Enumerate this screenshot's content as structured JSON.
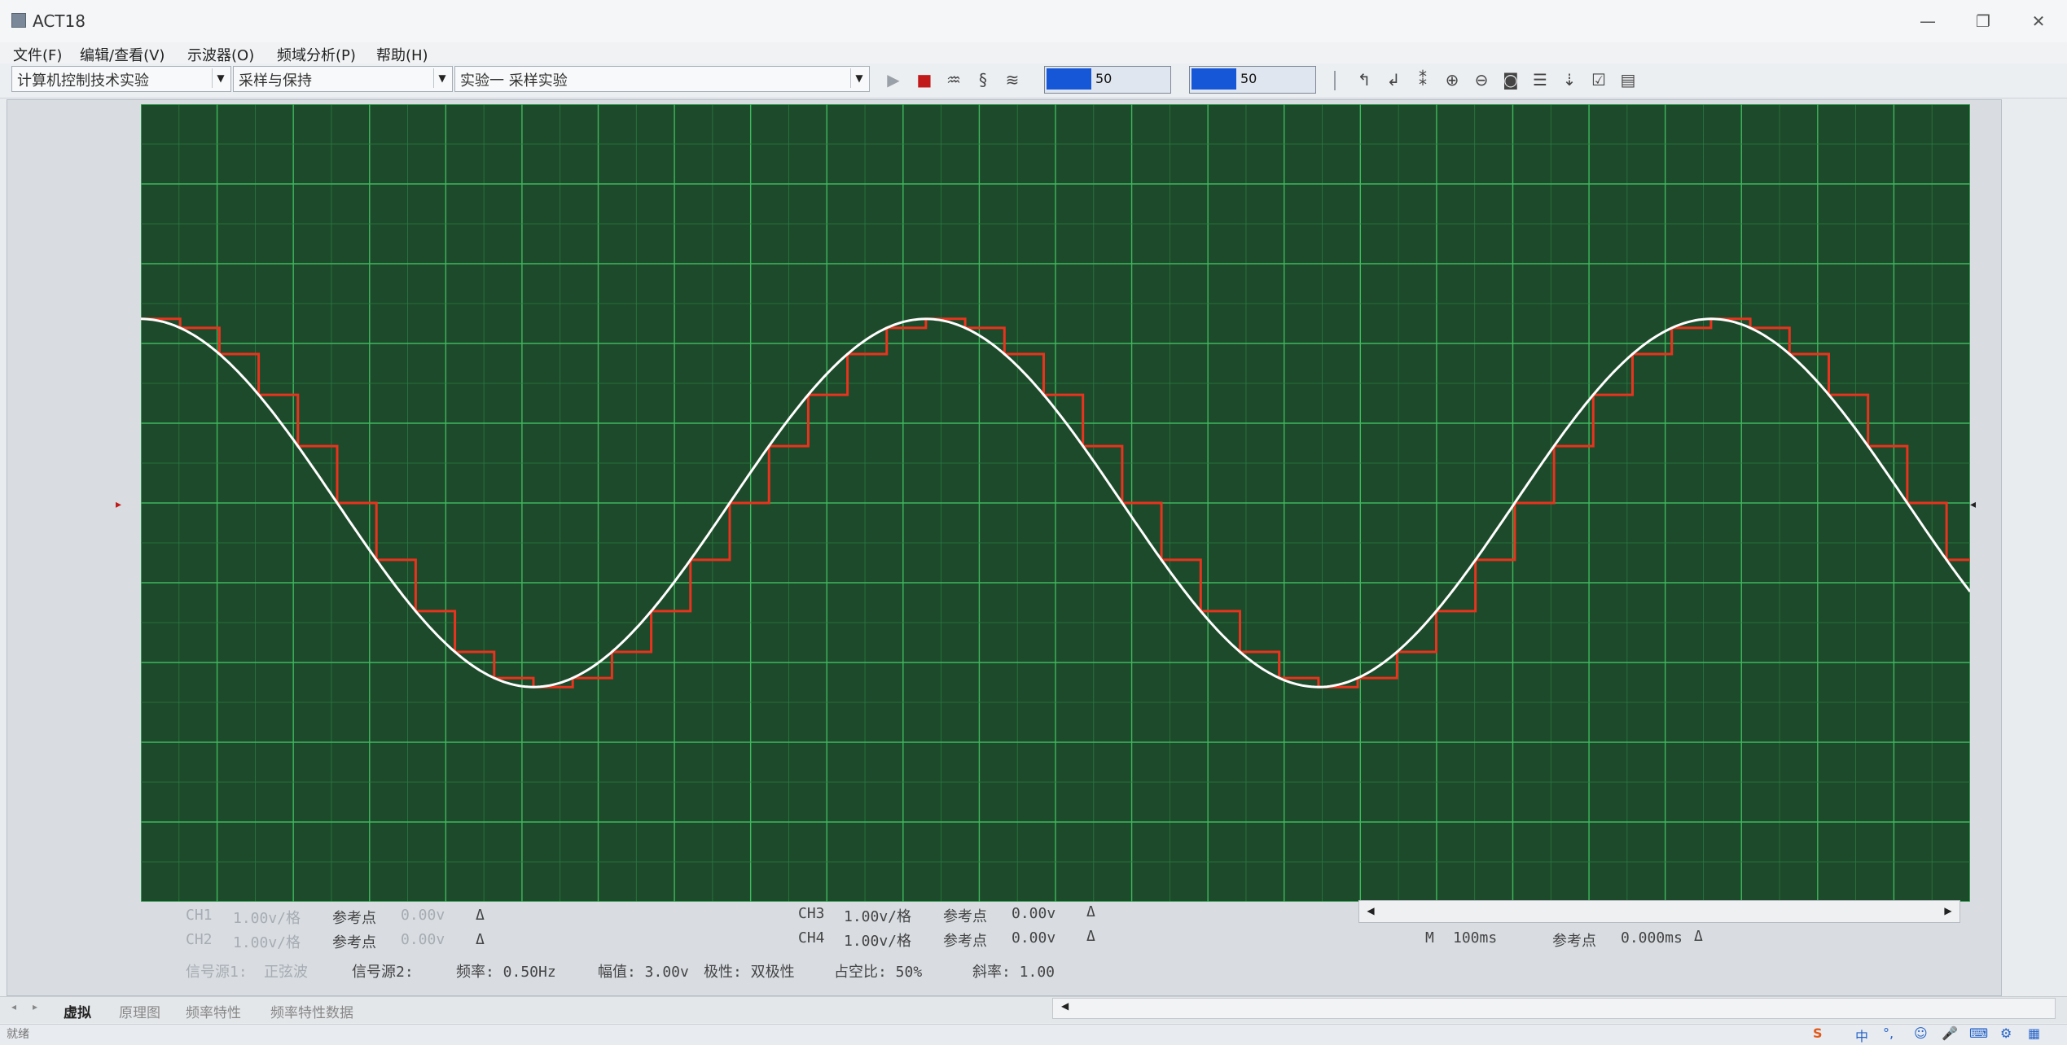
{
  "window": {
    "title": "ACT18"
  },
  "window_buttons": {
    "minimize": "—",
    "maximize": "❐",
    "close": "✕"
  },
  "menu": [
    "文件(F)",
    "编辑/查看(V)",
    "示波器(O)",
    "频域分析(P)",
    "帮助(H)"
  ],
  "toolbar": {
    "combo1": "计算机控制技术实验",
    "combo2": "采样与保持",
    "combo3": "实验一  采样实验",
    "play": "▶",
    "stop": "■",
    "slider1_value": "50",
    "slider2_value": "50"
  },
  "scope": {
    "background": "#1d4a2a",
    "grid_major": "#3fb85e",
    "grid_minor": "#2c7a43",
    "input_color": "#ffffff",
    "output_color": "#e8331e",
    "signal_freq_hz": 0.5,
    "amplitude_v": 3.0,
    "volts_per_div": 1.0,
    "time_per_div_ms": 100,
    "sample_period_ms": 100
  },
  "channels": {
    "ch1": {
      "label": "CH1",
      "scale": "1.00v/格",
      "ref_label": "参考点",
      "ref": "0.00v",
      "delta": "Δ"
    },
    "ch2": {
      "label": "CH2",
      "scale": "1.00v/格",
      "ref_label": "参考点",
      "ref": "0.00v",
      "delta": "Δ"
    },
    "ch3": {
      "label": "CH3",
      "scale": "1.00v/格",
      "ref_label": "参考点",
      "ref": "0.00v",
      "delta": "Δ"
    },
    "ch4": {
      "label": "CH4",
      "scale": "1.00v/格",
      "ref_label": "参考点",
      "ref": "0.00v",
      "delta": "Δ"
    }
  },
  "timebase": {
    "label": "M",
    "value": "100ms",
    "ref_label": "参考点",
    "ref": "0.000ms",
    "delta": "Δ"
  },
  "signal": {
    "source1_label": "信号源1:",
    "source1": "正弦波",
    "source2_label": "信号源2:",
    "freq": "频率: 0.50Hz",
    "amp": "幅值: 3.00v",
    "polarity": "极性: 双极性",
    "duty": "占空比: 50%",
    "slope": "斜率: 1.00"
  },
  "tabs": [
    "虚拟",
    "原理图",
    "频率特性",
    "频率特性数据"
  ],
  "status": "就绪",
  "tray": {
    "ime": "中",
    "s_logo": "S"
  }
}
